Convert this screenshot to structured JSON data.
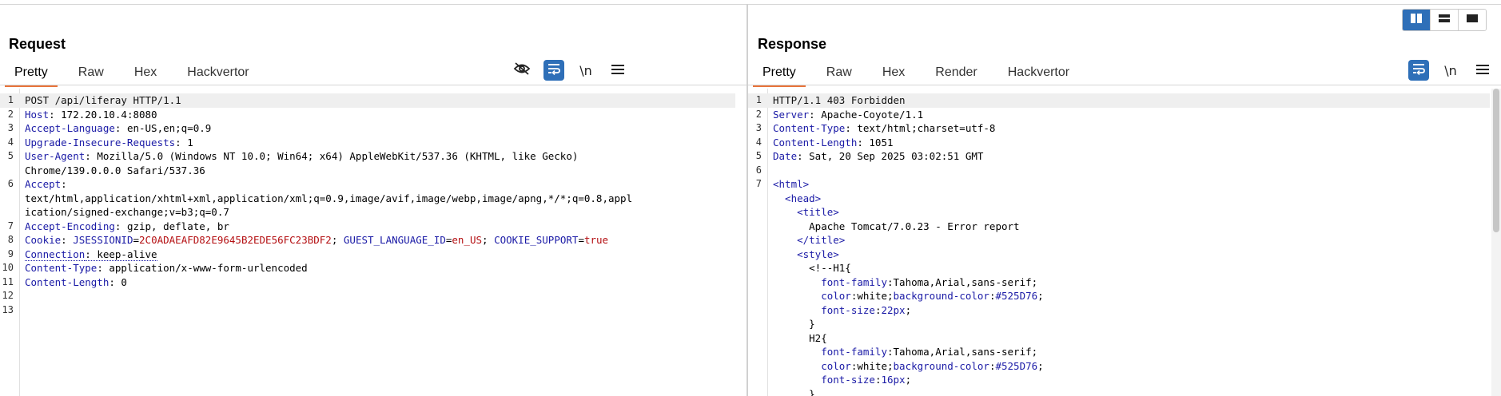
{
  "layout_buttons": [
    {
      "icon": "split-columns-icon",
      "active": true
    },
    {
      "icon": "split-rows-icon",
      "active": false
    },
    {
      "icon": "single-pane-icon",
      "active": false
    }
  ],
  "request": {
    "title": "Request",
    "tabs": [
      "Pretty",
      "Raw",
      "Hex",
      "Hackvertor"
    ],
    "active_tab": "Pretty",
    "tools": [
      "hide-icon",
      "wrap-icon",
      "newline-icon",
      "menu-icon"
    ],
    "newline_label": "\\n",
    "lines": [
      {
        "n": "1",
        "parts": [
          {
            "t": "POST /api/liferay HTTP/1.1",
            "c": ""
          }
        ]
      },
      {
        "n": "2",
        "parts": [
          {
            "t": "Host",
            "c": "hk"
          },
          {
            "t": ": 172.20.10.4:8080",
            "c": "hv"
          }
        ]
      },
      {
        "n": "3",
        "parts": [
          {
            "t": "Accept-Language",
            "c": "hk"
          },
          {
            "t": ": en-US,en;q=0.9",
            "c": "hv"
          }
        ]
      },
      {
        "n": "4",
        "parts": [
          {
            "t": "Upgrade-Insecure-Requests",
            "c": "hk"
          },
          {
            "t": ": 1",
            "c": "hv"
          }
        ]
      },
      {
        "n": "5",
        "parts": [
          {
            "t": "User-Agent",
            "c": "hk"
          },
          {
            "t": ": Mozilla/5.0 (Windows NT 10.0; Win64; x64) AppleWebKit/537.36 (KHTML, like Gecko)",
            "c": "hv"
          }
        ]
      },
      {
        "n": "",
        "parts": [
          {
            "t": "Chrome/139.0.0.0 Safari/537.36",
            "c": "hv"
          }
        ]
      },
      {
        "n": "6",
        "parts": [
          {
            "t": "Accept",
            "c": "hk"
          },
          {
            "t": ":",
            "c": "hv"
          }
        ]
      },
      {
        "n": "",
        "parts": [
          {
            "t": "text/html,application/xhtml+xml,application/xml;q=0.9,image/avif,image/webp,image/apng,*/*;q=0.8,appl",
            "c": "hv"
          }
        ]
      },
      {
        "n": "",
        "parts": [
          {
            "t": "ication/signed-exchange;v=b3;q=0.7",
            "c": "hv"
          }
        ]
      },
      {
        "n": "7",
        "parts": [
          {
            "t": "Accept-Encoding",
            "c": "hk"
          },
          {
            "t": ": gzip, deflate, br",
            "c": "hv"
          }
        ]
      },
      {
        "n": "8",
        "parts": [
          {
            "t": "Cookie",
            "c": "hk"
          },
          {
            "t": ": ",
            "c": "hv"
          },
          {
            "t": "JSESSIONID",
            "c": "ck"
          },
          {
            "t": "=",
            "c": "hv"
          },
          {
            "t": "2C0ADAEAFD82E9645B2EDE56FC23BDF2",
            "c": "cv"
          },
          {
            "t": "; ",
            "c": "hv"
          },
          {
            "t": "GUEST_LANGUAGE_ID",
            "c": "ck"
          },
          {
            "t": "=",
            "c": "hv"
          },
          {
            "t": "en_US",
            "c": "cv"
          },
          {
            "t": "; ",
            "c": "hv"
          },
          {
            "t": "COOKIE_SUPPORT",
            "c": "ck"
          },
          {
            "t": "=",
            "c": "hv"
          },
          {
            "t": "true",
            "c": "cv"
          }
        ]
      },
      {
        "n": "9",
        "parts": [
          {
            "t": "Connection",
            "c": "hk dotted"
          },
          {
            "t": ": keep-alive",
            "c": "hv dotted"
          }
        ]
      },
      {
        "n": "10",
        "parts": [
          {
            "t": "Content-Type",
            "c": "hk"
          },
          {
            "t": ": application/x-www-form-urlencoded",
            "c": "hv"
          }
        ]
      },
      {
        "n": "11",
        "parts": [
          {
            "t": "Content-Length",
            "c": "hk"
          },
          {
            "t": ": 0",
            "c": "hv"
          }
        ]
      },
      {
        "n": "12",
        "parts": []
      },
      {
        "n": "13",
        "parts": []
      }
    ]
  },
  "response": {
    "title": "Response",
    "tabs": [
      "Pretty",
      "Raw",
      "Hex",
      "Render",
      "Hackvertor"
    ],
    "active_tab": "Pretty",
    "tools": [
      "wrap-icon",
      "newline-icon",
      "menu-icon"
    ],
    "newline_label": "\\n",
    "lines": [
      {
        "n": "1",
        "parts": [
          {
            "t": "HTTP/1.1 403 Forbidden",
            "c": ""
          }
        ]
      },
      {
        "n": "2",
        "parts": [
          {
            "t": "Server",
            "c": "hk"
          },
          {
            "t": ": Apache-Coyote/1.1",
            "c": "hv"
          }
        ]
      },
      {
        "n": "3",
        "parts": [
          {
            "t": "Content-Type",
            "c": "hk"
          },
          {
            "t": ": text/html;charset=utf-8",
            "c": "hv"
          }
        ]
      },
      {
        "n": "4",
        "parts": [
          {
            "t": "Content-Length",
            "c": "hk"
          },
          {
            "t": ": 1051",
            "c": "hv"
          }
        ]
      },
      {
        "n": "5",
        "parts": [
          {
            "t": "Date",
            "c": "hk"
          },
          {
            "t": ": Sat, 20 Sep 2025 03:02:51 GMT",
            "c": "hv"
          }
        ]
      },
      {
        "n": "6",
        "parts": []
      },
      {
        "n": "7",
        "parts": [
          {
            "t": "<html>",
            "c": "tag"
          }
        ]
      },
      {
        "n": "",
        "parts": [
          {
            "t": "  <head>",
            "c": "tag"
          }
        ]
      },
      {
        "n": "",
        "parts": [
          {
            "t": "    <title>",
            "c": "tag"
          }
        ]
      },
      {
        "n": "",
        "parts": [
          {
            "t": "      Apache Tomcat/7.0.23 - Error report",
            "c": "hv"
          }
        ]
      },
      {
        "n": "",
        "parts": [
          {
            "t": "    </title>",
            "c": "tag"
          }
        ]
      },
      {
        "n": "",
        "parts": [
          {
            "t": "    <style>",
            "c": "tag"
          }
        ]
      },
      {
        "n": "",
        "parts": [
          {
            "t": "      <!--H1{",
            "c": "hv"
          }
        ]
      },
      {
        "n": "",
        "parts": [
          {
            "t": "        font-family",
            "c": "hk"
          },
          {
            "t": ":Tahoma,Arial,sans-serif;",
            "c": "hv"
          }
        ]
      },
      {
        "n": "",
        "parts": [
          {
            "t": "        color",
            "c": "hk"
          },
          {
            "t": ":white;",
            "c": "hv"
          },
          {
            "t": "background-color",
            "c": "hk"
          },
          {
            "t": ":",
            "c": "hv"
          },
          {
            "t": "#525D76",
            "c": "cssv"
          },
          {
            "t": ";",
            "c": "hv"
          }
        ]
      },
      {
        "n": "",
        "parts": [
          {
            "t": "        font-size",
            "c": "hk"
          },
          {
            "t": ":",
            "c": "hv"
          },
          {
            "t": "22px",
            "c": "cssv"
          },
          {
            "t": ";",
            "c": "hv"
          }
        ]
      },
      {
        "n": "",
        "parts": [
          {
            "t": "      }",
            "c": "hv"
          }
        ]
      },
      {
        "n": "",
        "parts": [
          {
            "t": "      H2{",
            "c": "hv"
          }
        ]
      },
      {
        "n": "",
        "parts": [
          {
            "t": "        font-family",
            "c": "hk"
          },
          {
            "t": ":Tahoma,Arial,sans-serif;",
            "c": "hv"
          }
        ]
      },
      {
        "n": "",
        "parts": [
          {
            "t": "        color",
            "c": "hk"
          },
          {
            "t": ":white;",
            "c": "hv"
          },
          {
            "t": "background-color",
            "c": "hk"
          },
          {
            "t": ":",
            "c": "hv"
          },
          {
            "t": "#525D76",
            "c": "cssv"
          },
          {
            "t": ";",
            "c": "hv"
          }
        ]
      },
      {
        "n": "",
        "parts": [
          {
            "t": "        font-size",
            "c": "hk"
          },
          {
            "t": ":",
            "c": "hv"
          },
          {
            "t": "16px",
            "c": "cssv"
          },
          {
            "t": ";",
            "c": "hv"
          }
        ]
      },
      {
        "n": "",
        "parts": [
          {
            "t": "      }",
            "c": "hv"
          }
        ]
      }
    ]
  }
}
